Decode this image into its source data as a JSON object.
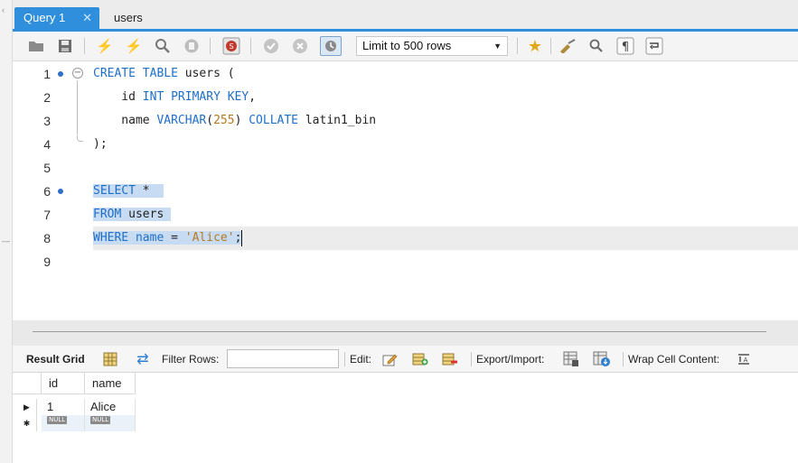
{
  "tabs": [
    {
      "label": "Query 1",
      "active": true
    },
    {
      "label": "users",
      "active": false
    }
  ],
  "toolbar": {
    "limit_select": "Limit to 500 rows"
  },
  "editor": {
    "lines": [
      {
        "num": "1",
        "text": "CREATE TABLE users ("
      },
      {
        "num": "2",
        "text": "id INT PRIMARY KEY,"
      },
      {
        "num": "3",
        "text": "name VARCHAR(255) COLLATE latin1_bin"
      },
      {
        "num": "4",
        "text": ");"
      },
      {
        "num": "5",
        "text": ""
      },
      {
        "num": "6",
        "text": "SELECT *"
      },
      {
        "num": "7",
        "text": "FROM users"
      },
      {
        "num": "8",
        "text": "WHERE name = 'Alice';"
      },
      {
        "num": "9",
        "text": ""
      }
    ]
  },
  "result_toolbar": {
    "result_grid": "Result Grid",
    "filter_rows": "Filter Rows:",
    "filter_value": "",
    "edit": "Edit:",
    "export_import": "Export/Import:",
    "wrap_cell": "Wrap Cell Content:"
  },
  "grid": {
    "columns": [
      "id",
      "name"
    ],
    "rows": [
      {
        "id": "1",
        "name": "Alice"
      }
    ],
    "null_label": "NULL"
  },
  "colors": {
    "accent": "#2f8fdc",
    "keyword": "#1f6fc9",
    "literal": "#b7791f",
    "selection": "#c7dbf2"
  }
}
